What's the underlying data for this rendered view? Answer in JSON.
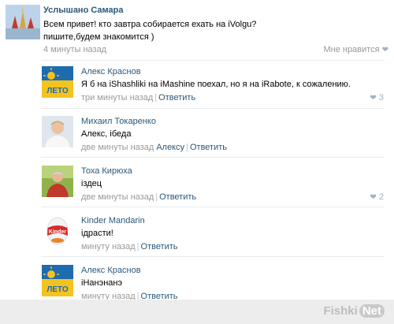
{
  "post": {
    "author": "Услышано Самара",
    "text_line1": "Всем привет! кто завтра собирается ехать на iVolgu?",
    "text_line2": "пишите,будем знакомится )",
    "time": "4 минуты назад",
    "like_label": "Мне нравится",
    "like_icon": "heart-icon"
  },
  "comments": [
    {
      "author": "Алекс Краснов",
      "text": "Я б на iShashliki на iMashine поехал, но я на iRabote, к сожалению.",
      "time": "три минуты назад",
      "reply_to": "",
      "reply_label": "Ответить",
      "likes": "3"
    },
    {
      "author": "Михаил Токаренко",
      "text": "Алекс, iбеда",
      "time": "две минуты назад",
      "reply_to": "Алексу",
      "reply_label": "Ответить",
      "likes": ""
    },
    {
      "author": "Тоха Кирюха",
      "text": "iздец",
      "time": "две минуты назад",
      "reply_to": "",
      "reply_label": "Ответить",
      "likes": "2"
    },
    {
      "author": "Kinder Mandarin",
      "text": "iдрасти!",
      "time": "минуту назад",
      "reply_to": "",
      "reply_label": "Ответить",
      "likes": ""
    },
    {
      "author": "Алекс Краснов",
      "text": "iНанэнанэ",
      "time": "минуту назад",
      "reply_to": "",
      "reply_label": "Ответить",
      "likes": ""
    }
  ],
  "watermark": {
    "part1": "Fishki",
    "part2": "Net"
  },
  "colors": {
    "link": "#2b587a",
    "meta": "#999999",
    "heart": "#9eb0c3"
  }
}
